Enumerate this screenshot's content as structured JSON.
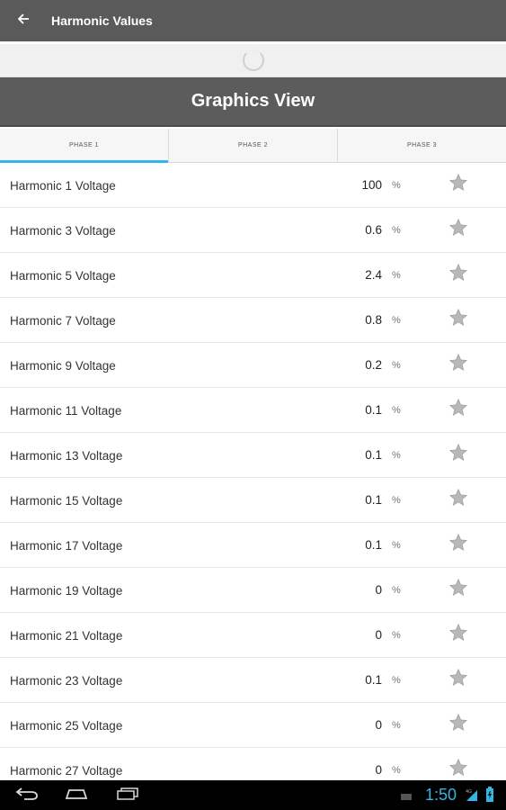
{
  "action_bar": {
    "title": "Harmonic Values",
    "back_icon": "arrow-left-icon"
  },
  "graphics_view": {
    "label": "Graphics View"
  },
  "tabs": [
    {
      "label": "PHASE 1",
      "active": true
    },
    {
      "label": "PHASE 2",
      "active": false
    },
    {
      "label": "PHASE 3",
      "active": false
    }
  ],
  "harmonics": [
    {
      "label": "Harmonic 1 Voltage",
      "value": "100",
      "unit": "%"
    },
    {
      "label": "Harmonic 3 Voltage",
      "value": "0.6",
      "unit": "%"
    },
    {
      "label": "Harmonic 5 Voltage",
      "value": "2.4",
      "unit": "%"
    },
    {
      "label": "Harmonic 7 Voltage",
      "value": "0.8",
      "unit": "%"
    },
    {
      "label": "Harmonic 9 Voltage",
      "value": "0.2",
      "unit": "%"
    },
    {
      "label": "Harmonic 11 Voltage",
      "value": "0.1",
      "unit": "%"
    },
    {
      "label": "Harmonic 13 Voltage",
      "value": "0.1",
      "unit": "%"
    },
    {
      "label": "Harmonic 15 Voltage",
      "value": "0.1",
      "unit": "%"
    },
    {
      "label": "Harmonic 17 Voltage",
      "value": "0.1",
      "unit": "%"
    },
    {
      "label": "Harmonic 19 Voltage",
      "value": "0",
      "unit": "%"
    },
    {
      "label": "Harmonic 21 Voltage",
      "value": "0",
      "unit": "%"
    },
    {
      "label": "Harmonic 23 Voltage",
      "value": "0.1",
      "unit": "%"
    },
    {
      "label": "Harmonic 25 Voltage",
      "value": "0",
      "unit": "%"
    },
    {
      "label": "Harmonic 27 Voltage",
      "value": "0",
      "unit": "%"
    }
  ],
  "system_bar": {
    "clock": "1:50",
    "icons": [
      "back-nav-icon",
      "home-nav-icon",
      "recents-nav-icon",
      "signal-icon",
      "battery-icon"
    ]
  },
  "colors": {
    "action_bar": "#5a5a5a",
    "tab_indicator": "#33b5e5",
    "star": "#b0b0b0"
  }
}
